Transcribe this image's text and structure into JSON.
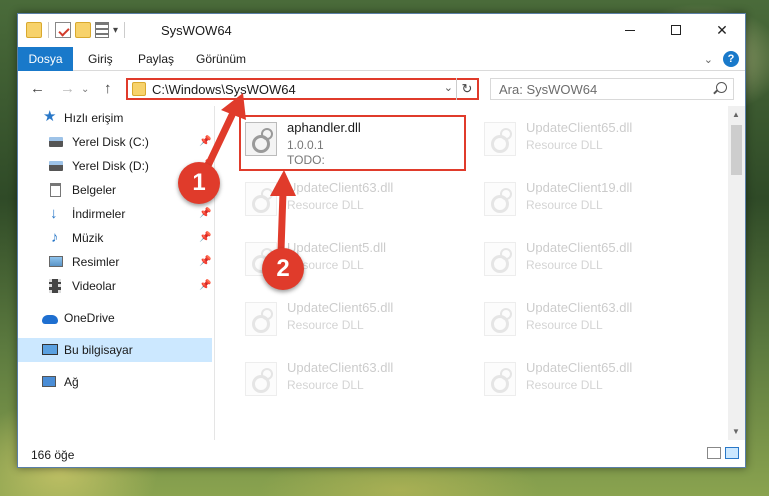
{
  "window": {
    "title": "SysWOW64",
    "close_glyph": "✕"
  },
  "ribbon": {
    "tabs": [
      "Dosya",
      "Giriş",
      "Paylaş",
      "Görünüm"
    ],
    "help_glyph": "?"
  },
  "nav": {
    "back_glyph": "←",
    "forward_glyph": "→",
    "up_glyph": "↑",
    "address": "C:\\Windows\\SysWOW64",
    "search_placeholder": "Ara: SysWOW64"
  },
  "sidebar": {
    "items": [
      {
        "label": "Hızlı erişim",
        "icon": "star-icon",
        "pinned": false
      },
      {
        "label": "Yerel Disk (C:)",
        "icon": "drive-icon",
        "pinned": true
      },
      {
        "label": "Yerel Disk (D:)",
        "icon": "drive-icon",
        "pinned": true
      },
      {
        "label": "Belgeler",
        "icon": "document-icon",
        "pinned": true
      },
      {
        "label": "İndirmeler",
        "icon": "download-icon",
        "pinned": true
      },
      {
        "label": "Müzik",
        "icon": "music-icon",
        "pinned": true
      },
      {
        "label": "Resimler",
        "icon": "pictures-icon",
        "pinned": true
      },
      {
        "label": "Videolar",
        "icon": "videos-icon",
        "pinned": true
      },
      {
        "label": "OneDrive",
        "icon": "cloud-icon",
        "pinned": false
      },
      {
        "label": "Bu bilgisayar",
        "icon": "computer-icon",
        "pinned": false,
        "selected": true
      },
      {
        "label": "Ağ",
        "icon": "network-icon",
        "pinned": false
      }
    ]
  },
  "files": {
    "main": {
      "name": "aphandler.dll",
      "line1": "1.0.0.1",
      "line2": "TODO:"
    },
    "faded": [
      {
        "name": "UpdateClient65.dll",
        "desc": "Resource DLL"
      },
      {
        "name": "UpdateClient63.dll",
        "desc": "Resource DLL"
      },
      {
        "name": "UpdateClient19.dll",
        "desc": "Resource DLL"
      },
      {
        "name": "UpdateClient5.dll",
        "desc": "Resource DLL"
      },
      {
        "name": "UpdateClient65.dll",
        "desc": "Resource DLL"
      },
      {
        "name": "UpdateClient65.dll",
        "desc": "Resource DLL"
      },
      {
        "name": "UpdateClient63.dll",
        "desc": "Resource DLL"
      },
      {
        "name": "UpdateClient63.dll",
        "desc": "Resource DLL"
      },
      {
        "name": "UpdateClient65.dll",
        "desc": "Resource DLL"
      }
    ]
  },
  "status": {
    "count": "166 öğe"
  },
  "annotations": {
    "step1": "1",
    "step2": "2",
    "color": "#e03b2b"
  }
}
